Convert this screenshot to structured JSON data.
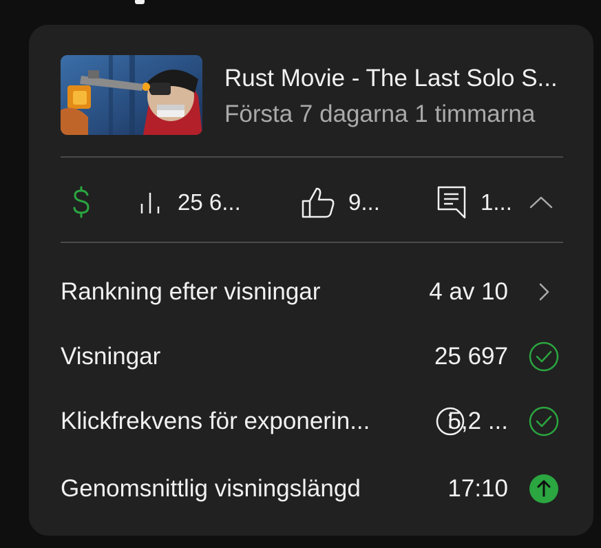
{
  "video": {
    "title": "Rust Movie - The Last Solo S...",
    "subtitle": "Första 7 dagarna 1 timmarna"
  },
  "stats": {
    "revenue_icon": "dollar-icon",
    "views": "25 6...",
    "likes": "9...",
    "comments": "1..."
  },
  "rows": [
    {
      "label": "Rankning efter visningar",
      "value": "4 av 10",
      "icon": "chevron-right-icon"
    },
    {
      "label": "Visningar",
      "value": "25 697",
      "icon": "check-circle-icon"
    },
    {
      "label": "Klickfrekvens för exponerin...",
      "value": "5,2 ...",
      "icon": "check-circle-icon",
      "info_icon": "info-icon"
    },
    {
      "label": "Genomsnittlig visningslängd",
      "value": "17:10",
      "icon": "arrow-up-circle-icon"
    }
  ],
  "colors": {
    "background": "#0f0f0f",
    "card": "#212121",
    "green": "#2ba640",
    "muted": "#aaaaaa"
  }
}
